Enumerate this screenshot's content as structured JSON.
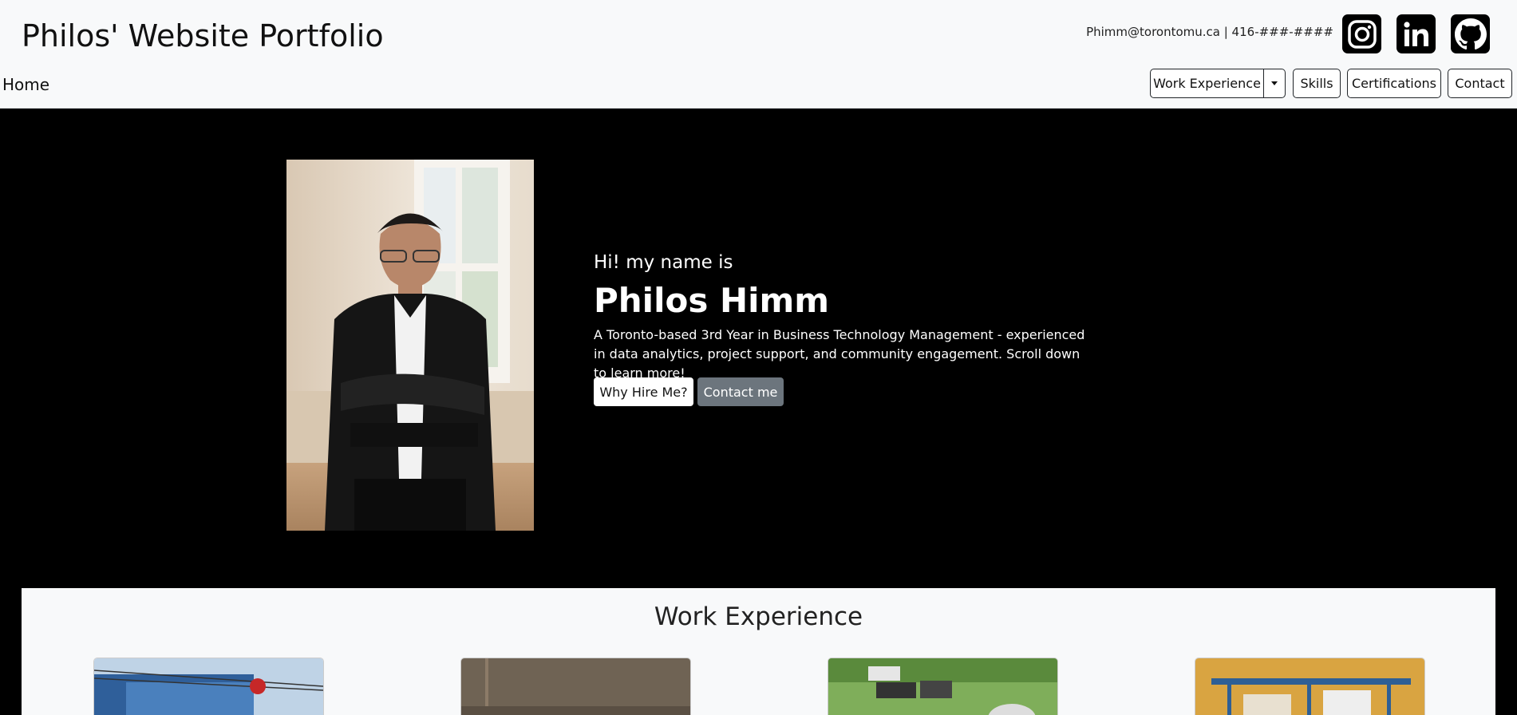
{
  "header": {
    "site_title": "Philos' Website Portfolio",
    "contact_line": "Phimm@torontomu.ca | 416-###-####",
    "social_icons": [
      "instagram-icon",
      "linkedin-icon",
      "github-icon"
    ]
  },
  "nav": {
    "home": "Home",
    "work_experience": "Work Experience",
    "skills": "Skills",
    "certifications": "Certifications",
    "contact": "Contact"
  },
  "hero": {
    "intro": "Hi! my name is",
    "name": "Philos Himm",
    "description": "A Toronto-based 3rd Year in Business Technology Management - experienced in data analytics, project support, and community engagement. Scroll down to learn more!",
    "why_hire_button": "Why Hire Me?",
    "contact_button": "Contact me"
  },
  "work_experience": {
    "title": "Work Experience"
  },
  "colors": {
    "header_bg": "#f8f9fa",
    "hero_bg": "#000000",
    "secondary_button": "#6c757d"
  }
}
